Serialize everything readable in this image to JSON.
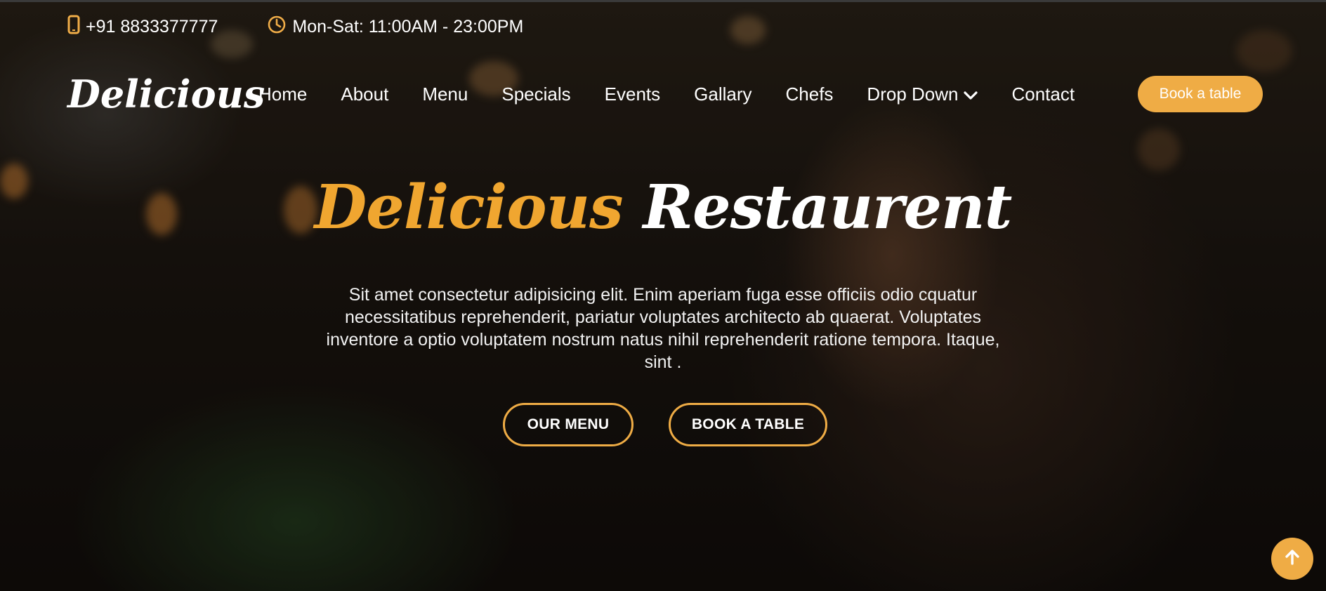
{
  "topbar": {
    "phone_icon": "mobile-phone-icon",
    "phone": "+91 8833377777",
    "hours_icon": "clock-icon",
    "hours": "Mon-Sat: 11:00AM - 23:00PM"
  },
  "brand": {
    "logo": "Delicious"
  },
  "nav": {
    "items": [
      {
        "label": "Home"
      },
      {
        "label": "About"
      },
      {
        "label": "Menu"
      },
      {
        "label": "Specials"
      },
      {
        "label": "Events"
      },
      {
        "label": "Gallary"
      },
      {
        "label": "Chefs"
      },
      {
        "label": "Drop Down",
        "icon": "chevron-down-icon"
      },
      {
        "label": "Contact"
      }
    ],
    "cta": "Book a table"
  },
  "hero": {
    "title_part1": "Delicious",
    "title_part2": "Restaurent",
    "description": "Sit amet consectetur adipisicing elit. Enim aperiam fuga esse officiis odio cquatur necessitatibus reprehenderit, pariatur voluptates architecto ab quaerat. Voluptates inventore a optio voluptatem nostrum natus nihil reprehenderit ratione tempora. Itaque, sint .",
    "buttons": {
      "menu": "OUR MENU",
      "table": "BOOK A TABLE"
    }
  },
  "scroll_top": {
    "icon": "arrow-up-icon"
  },
  "colors": {
    "accent": "#efac45",
    "title_accent": "#f0a630",
    "text": "#ffffff"
  }
}
